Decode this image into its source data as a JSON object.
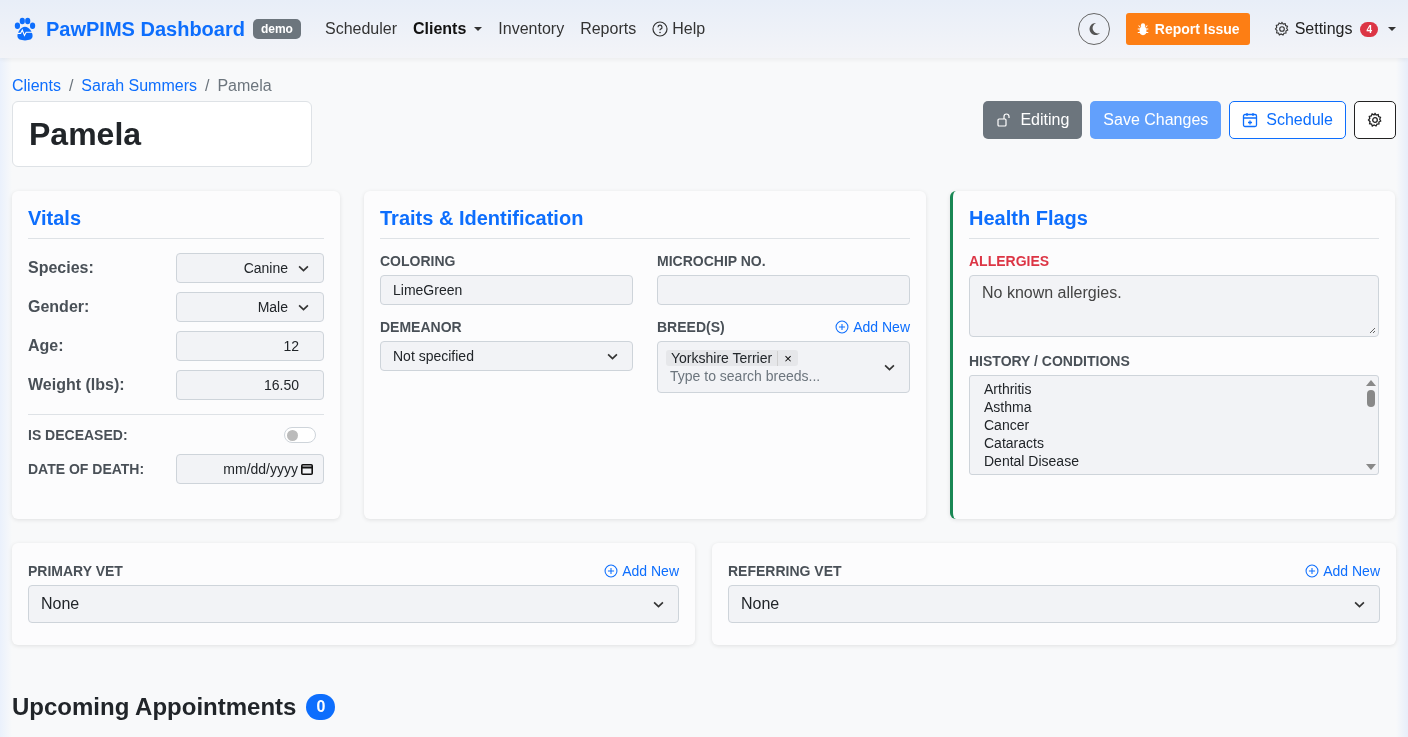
{
  "nav": {
    "brand": "PawPIMS Dashboard",
    "badge": "demo",
    "links": [
      {
        "label": "Scheduler",
        "selected": false,
        "dropdown": false
      },
      {
        "label": "Clients",
        "selected": true,
        "dropdown": true
      },
      {
        "label": "Inventory",
        "selected": false,
        "dropdown": false
      },
      {
        "label": "Reports",
        "selected": false,
        "dropdown": false
      }
    ],
    "help": "Help",
    "report": "Report Issue",
    "settings": {
      "label": "Settings",
      "count": "4"
    }
  },
  "breadcrumb": {
    "separator": "/",
    "items": [
      "Clients",
      "Sarah Summers",
      "Pamela"
    ]
  },
  "title": "Pamela",
  "actions": {
    "editing": "Editing",
    "save": {
      "label": "Save Changes",
      "disabled": true
    },
    "schedule": "Schedule"
  },
  "vitals": {
    "title": "Vitals",
    "fields": [
      {
        "kind": "select",
        "label": "Species:",
        "value": "Canine"
      },
      {
        "kind": "select",
        "label": "Gender:",
        "value": "Male"
      },
      {
        "kind": "number",
        "label": "Age:",
        "value": "12"
      },
      {
        "kind": "number",
        "label": "Weight (lbs):",
        "value": "16.50"
      }
    ],
    "deceased": {
      "label": "IS DECEASED:",
      "on": false
    },
    "death": {
      "label": "DATE OF DEATH:",
      "placeholder": "mm/dd/yyyy"
    }
  },
  "traits": {
    "title": "Traits & Identification",
    "coloring": {
      "label": "COLORING",
      "value": "LimeGreen"
    },
    "microchip": {
      "label": "MICROCHIP NO."
    },
    "demeanor": {
      "label": "DEMEANOR",
      "value": "Not specified"
    },
    "breeds": {
      "label": "BREED(S)",
      "add": "Add New",
      "tags": [
        "Yorkshire Terrier"
      ],
      "remove": "×",
      "placeholder": "Type to search breeds..."
    }
  },
  "health": {
    "title": "Health Flags",
    "allergies": {
      "label": "ALLERGIES",
      "value": "No known allergies."
    },
    "history": {
      "label": "HISTORY / CONDITIONS",
      "items": [
        {
          "label": "Arthritis",
          "selected": false
        },
        {
          "label": "Asthma",
          "selected": false
        },
        {
          "label": "Cancer",
          "selected": false
        },
        {
          "label": "Cataracts",
          "selected": false
        },
        {
          "label": "Dental Disease",
          "selected": false
        }
      ]
    }
  },
  "vets": [
    {
      "label": "PRIMARY VET",
      "add": "Add New",
      "value": "None"
    },
    {
      "label": "REFERRING VET",
      "add": "Add New",
      "value": "None"
    }
  ],
  "appointments": {
    "title": "Upcoming Appointments",
    "count": "0"
  }
}
